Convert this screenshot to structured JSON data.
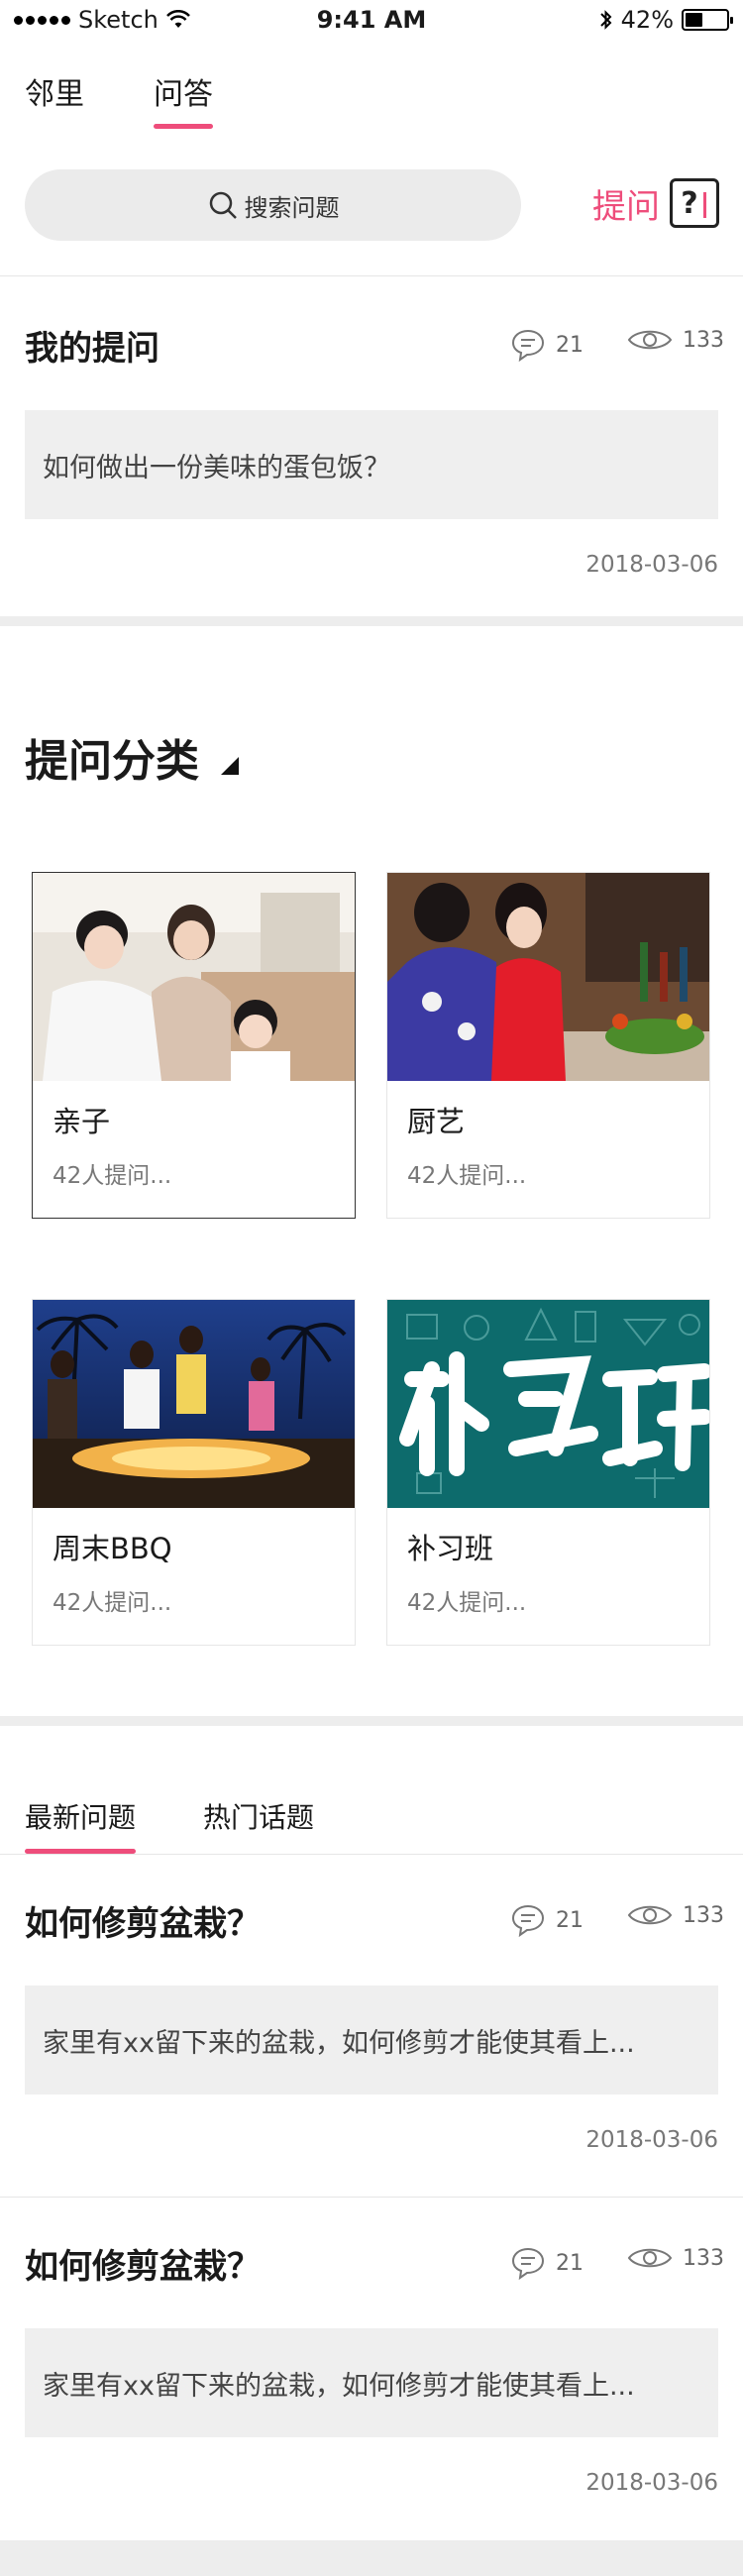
{
  "status_bar": {
    "carrier": "Sketch",
    "time": "9:41 AM",
    "battery": "42%",
    "battery_level": 0.42
  },
  "top_tabs": [
    {
      "label": "邻里",
      "active": false
    },
    {
      "label": "问答",
      "active": true
    }
  ],
  "search": {
    "placeholder": "搜索问题"
  },
  "ask_button": {
    "label": "提问",
    "icon": "question-box-icon"
  },
  "my_question": {
    "title": "我的提问",
    "comments": "21",
    "views": "133",
    "content": "如何做出一份美味的蛋包饭？",
    "date": "2018-03-06"
  },
  "categories_title": "提问分类",
  "categories": [
    {
      "name": "亲子",
      "count": "42人提问...",
      "image": "family-photo"
    },
    {
      "name": "厨艺",
      "count": "42人提问...",
      "image": "cooking-photo"
    },
    {
      "name": "周末BBQ",
      "count": "42人提问...",
      "image": "bbq-photo"
    },
    {
      "name": "补习班",
      "count": "42人提问...",
      "image": "tutoring-photo"
    }
  ],
  "bottom_tabs": [
    {
      "label": "最新问题",
      "active": true
    },
    {
      "label": "热门话题",
      "active": false
    }
  ],
  "latest_questions": [
    {
      "title": "如何修剪盆栽？",
      "comments": "21",
      "views": "133",
      "content": "家里有xx留下来的盆栽，如何修剪才能使其看上...",
      "date": "2018-03-06"
    },
    {
      "title": "如何修剪盆栽？",
      "comments": "21",
      "views": "133",
      "content": "家里有xx留下来的盆栽，如何修剪才能使其看上...",
      "date": "2018-03-06"
    }
  ],
  "colors": {
    "accent": "#ee4d7b",
    "text": "#1a1a1a",
    "muted": "#777777",
    "panel": "#efefef"
  }
}
